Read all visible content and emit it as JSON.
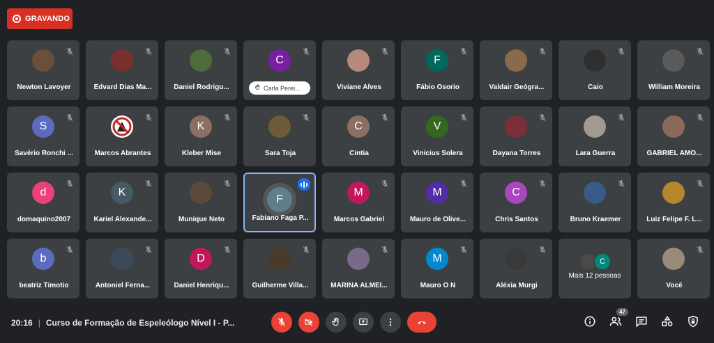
{
  "recording": {
    "label": "GRAVANDO"
  },
  "participants": [
    {
      "name": "Newton Lavoyer",
      "initial": "",
      "color": "#6b4f3a"
    },
    {
      "name": "Edvard Dias Ma...",
      "initial": "",
      "color": "#7a2f2f"
    },
    {
      "name": "Daniel Rodrigu...",
      "initial": "",
      "color": "#4e6b3a"
    },
    {
      "name": "Carla Perei...",
      "initial": "C",
      "color": "#7b1fa2",
      "pill": true
    },
    {
      "name": "Viviane Alves",
      "initial": "",
      "color": "#b58a7a"
    },
    {
      "name": "Fábio Osorio",
      "initial": "F",
      "color": "#00695c"
    },
    {
      "name": "Valdair Geógra...",
      "initial": "",
      "color": "#8a6a4a"
    },
    {
      "name": "Caio",
      "initial": "",
      "color": "#2f2f2f"
    },
    {
      "name": "William Moreira",
      "initial": "",
      "color": "#5a5a5a"
    },
    {
      "name": "Savério Ronchi ...",
      "initial": "S",
      "color": "#5c6bc0"
    },
    {
      "name": "Marcos Abrantes",
      "initial": "",
      "color": "#ffffff"
    },
    {
      "name": "Kleber Mise",
      "initial": "K",
      "color": "#8d6e63"
    },
    {
      "name": "Sara Toja",
      "initial": "",
      "color": "#6d5a3a"
    },
    {
      "name": "Cintia",
      "initial": "C",
      "color": "#8d6e63"
    },
    {
      "name": "Vinicius Solera",
      "initial": "V",
      "color": "#33691e"
    },
    {
      "name": "Dayana Torres",
      "initial": "",
      "color": "#7a2f3a"
    },
    {
      "name": "Lara Guerra",
      "initial": "",
      "color": "#a09a92"
    },
    {
      "name": "GABRIEL AMO...",
      "initial": "",
      "color": "#8a6a5a"
    },
    {
      "name": "domaquino2007",
      "initial": "d",
      "color": "#ec407a"
    },
    {
      "name": "Kariel Alexande...",
      "initial": "K",
      "color": "#455a64"
    },
    {
      "name": "Munique Neto",
      "initial": "",
      "color": "#5a4a3a"
    },
    {
      "name": "Fabiano Faga P...",
      "initial": "F",
      "color": "#607d8b",
      "active": true
    },
    {
      "name": "Marcos Gabriel",
      "initial": "M",
      "color": "#c2185b"
    },
    {
      "name": "Mauro de Olive...",
      "initial": "M",
      "color": "#512da8"
    },
    {
      "name": "Chris Santos",
      "initial": "C",
      "color": "#ab47bc"
    },
    {
      "name": "Bruno Kraemer",
      "initial": "",
      "color": "#3a5a8a"
    },
    {
      "name": "Luiz Felipe F. L...",
      "initial": "",
      "color": "#b8862a"
    },
    {
      "name": "beatriz Timotio",
      "initial": "b",
      "color": "#5c6bc0"
    },
    {
      "name": "Antoniel Ferna...",
      "initial": "",
      "color": "#3a4a5a"
    },
    {
      "name": "Daniel Henriqu...",
      "initial": "D",
      "color": "#c2185b"
    },
    {
      "name": "Guilherme Villa...",
      "initial": "",
      "color": "#4a3a2a"
    },
    {
      "name": "MARINA ALMEI...",
      "initial": "",
      "color": "#7a6a8a"
    },
    {
      "name": "Mauro O N",
      "initial": "M",
      "color": "#0288d1"
    },
    {
      "name": "Aléxia Murgi",
      "initial": "",
      "color": "#3a3a3a"
    },
    {
      "name": "Mais 12 pessoas",
      "more": true,
      "initial": "C",
      "color": "#00897b"
    },
    {
      "name": "Você",
      "initial": "",
      "color": "#9a8a7a"
    }
  ],
  "footer": {
    "time": "20:16",
    "separator": "|",
    "meeting_title": "Curso de Formação de Espeleólogo Nível I - P...",
    "people_count": "47"
  }
}
